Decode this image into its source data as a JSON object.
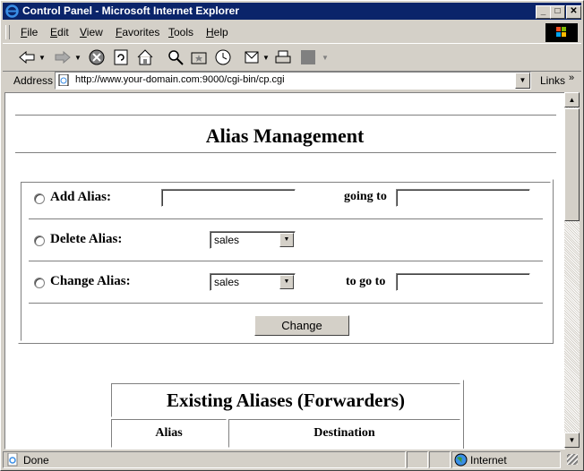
{
  "window": {
    "title": "Control Panel - Microsoft Internet Explorer"
  },
  "menu": [
    "File",
    "Edit",
    "View",
    "Favorites",
    "Tools",
    "Help"
  ],
  "address": {
    "label": "Address",
    "url": "http://www.your-domain.com:9000/cgi-bin/cp.cgi",
    "links_label": "Links"
  },
  "page": {
    "heading": "Alias Management",
    "form": {
      "add_label": "Add Alias:",
      "going_to_label": "going to",
      "delete_label": "Delete Alias:",
      "delete_selected": "sales",
      "change_label": "Change Alias:",
      "change_selected": "sales",
      "to_go_to_label": "to go to",
      "submit_label": "Change"
    },
    "aliases_table": {
      "title": "Existing Aliases (Forwarders)",
      "columns": [
        "Alias",
        "Destination"
      ]
    }
  },
  "status": {
    "text": "Done",
    "zone": "Internet"
  }
}
